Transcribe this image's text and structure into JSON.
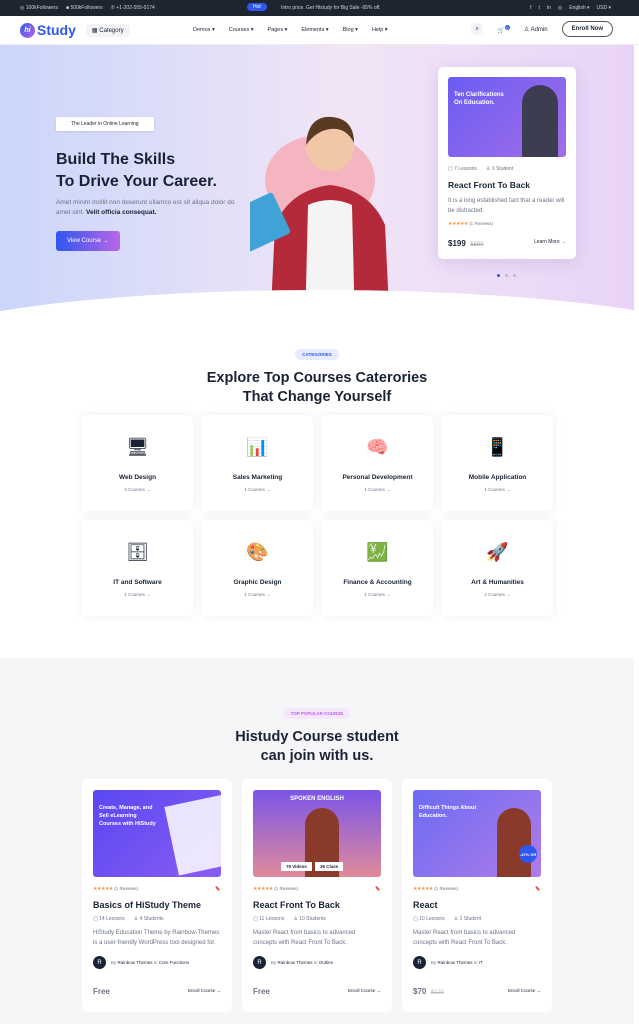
{
  "topbar": {
    "instagram": "100kFollowers",
    "facebook": "500kFollowers",
    "phone": "+1-202-555-0174",
    "hot": "Hot",
    "promo": "Intro price. Get Histudy for Big Sale -95% off.",
    "language": "English",
    "currency": "USD"
  },
  "nav": {
    "logo": "Study",
    "logo_mark": "hi",
    "category": "Category",
    "menu": [
      "Demos",
      "Courses",
      "Pages",
      "Elements",
      "Blog",
      "Help"
    ],
    "cart_count": "0",
    "admin": "Admin",
    "enroll": "Enroll Now"
  },
  "hero": {
    "tag": "The Leader in Online Learning",
    "title1": "Build The Skills",
    "title2": "To Drive Your Career.",
    "sub": "Amet minim mollit non deserunt ullamco est sit aliqua dolor do amet sint.",
    "sub_bold": "Velit officia consequat.",
    "button": "View Course",
    "card": {
      "thumb_title": "Ten Clarifications On Education.",
      "lessons": "7 Lessons",
      "students": "1 Student",
      "title": "React Front To Back",
      "desc": "It is a long established fact that a reader will be distracted.",
      "reviews": "(1 Reviews)",
      "price": "$199",
      "old_price": "$590",
      "link": "Learn More"
    }
  },
  "categories": {
    "badge": "CATEGORIES",
    "title1": "Explore Top Courses Caterories",
    "title2": "That Change Yourself",
    "items": [
      {
        "name": "Web Design",
        "count": "3 Courses",
        "icon": "🖥"
      },
      {
        "name": "Sales Marketing",
        "count": "1 Courses",
        "icon": "📊"
      },
      {
        "name": "Personal Development",
        "count": "1 Courses",
        "icon": "🧠"
      },
      {
        "name": "Mobile Application",
        "count": "1 Courses",
        "icon": "📱"
      },
      {
        "name": "IT and Software",
        "count": "1 Courses",
        "icon": "🗄"
      },
      {
        "name": "Graphic Design",
        "count": "1 Courses",
        "icon": "🎨"
      },
      {
        "name": "Finance & Accounting",
        "count": "1 Courses",
        "icon": "💹"
      },
      {
        "name": "Art & Humanities",
        "count": "2 Courses",
        "icon": "🚀"
      }
    ]
  },
  "courses": {
    "badge": "TOP POPULAR COURSE",
    "title1": "Histudy Course student",
    "title2": "can join with us.",
    "items": [
      {
        "thumb": "Create, Manage, and Sell eLearning Courses with HiStudy",
        "reviews": "(1 Reviews)",
        "title": "Basics of HiStudy Theme",
        "lessons": "14 Lessons",
        "students": "4 Students",
        "desc": "HiStudy Education Theme by Rainbow-Themes is a user-friendly WordPress tool designed for.",
        "by": "By",
        "author": "Rainbow Themes",
        "in": "In",
        "category": "Core Functions",
        "price": "Free",
        "old_price": "",
        "link": "Enroll Course"
      },
      {
        "thumb": "SPOKEN ENGLISH",
        "thumb_tags": [
          "75 Videos",
          "35 Class"
        ],
        "reviews": "(1 Reviews)",
        "title": "React Front To Back",
        "lessons": "11 Lessons",
        "students": "10 Students",
        "desc": "Master React from basics to advanced concepts with React Front To Back.",
        "by": "By",
        "author": "Rainbow Themes",
        "in": "In",
        "category": "Outline",
        "price": "Free",
        "old_price": "",
        "link": "Enroll Course"
      },
      {
        "thumb": "Difficult Things About Education.",
        "thumb_badge": "-47% Off",
        "reviews": "(1 Reviews)",
        "title": "React",
        "lessons": "10 Lessons",
        "students": "1 Student",
        "desc": "Master React from basics to advanced concepts with React Front To Back.",
        "by": "By",
        "author": "Rainbow Themes",
        "in": "In",
        "category": "IT",
        "price": "$70",
        "old_price": "$120",
        "link": "Enroll Course"
      }
    ]
  },
  "colors": {
    "primary": "#2f57ef",
    "secondary": "#b966e7",
    "dark": "#192335",
    "star": "#ff8f3c"
  }
}
